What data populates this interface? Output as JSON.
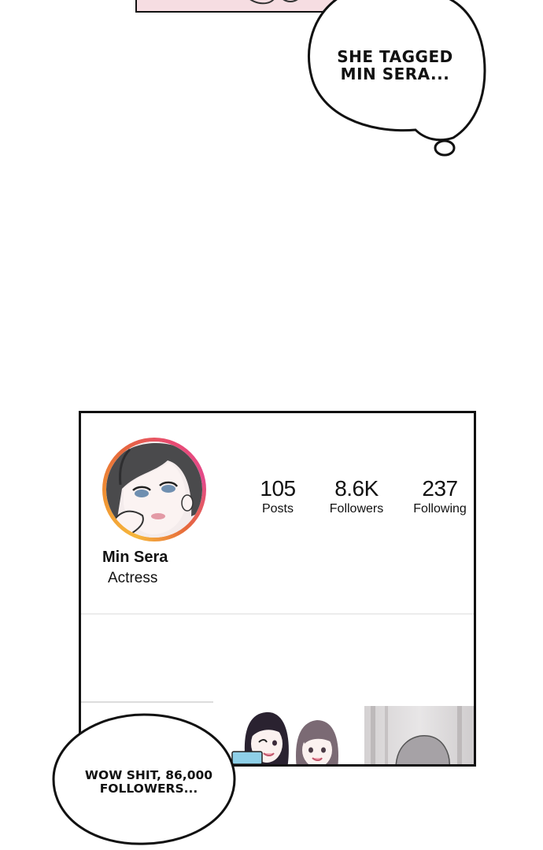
{
  "thought_bubble": {
    "text": "SHE TAGGED\nMIN SERA..."
  },
  "speech_bubble": {
    "text": "WOW SHIT, 86,000\nFOLLOWERS..."
  },
  "profile": {
    "name": "Min Sera",
    "bio": "Actress",
    "avatar_icon": "profile-avatar-illustration",
    "ring_colors": [
      "#f6b73c",
      "#e84a72"
    ],
    "stats": [
      {
        "value": "105",
        "label": "Posts"
      },
      {
        "value": "8.6K",
        "label": "Followers"
      },
      {
        "value": "237",
        "label": "Following"
      }
    ]
  }
}
